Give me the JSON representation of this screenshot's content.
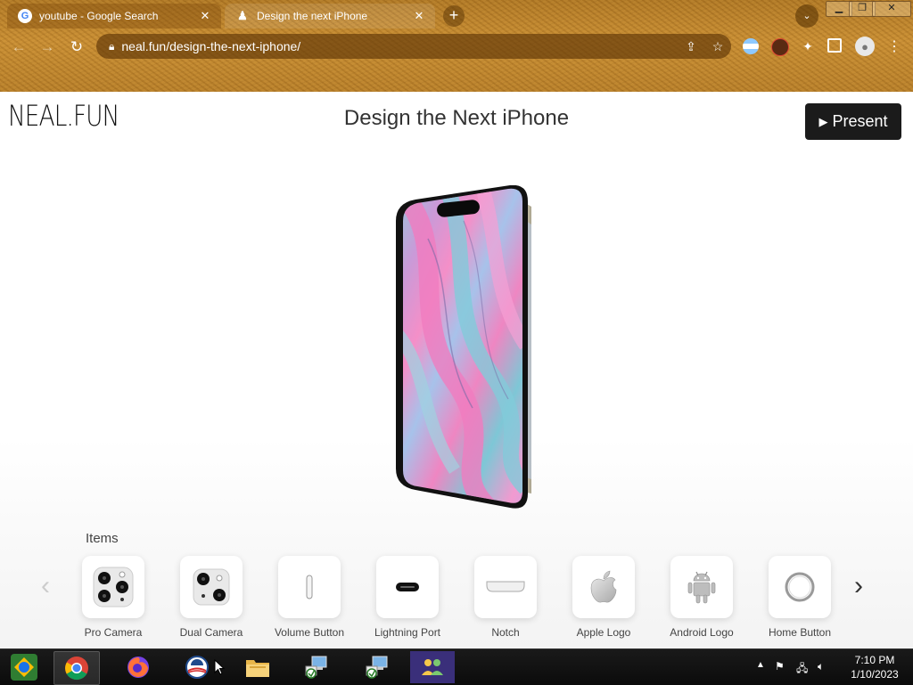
{
  "browser": {
    "tabs": [
      {
        "title": "youtube - Google Search",
        "favicon": "google-icon"
      },
      {
        "title": "Design the next iPhone",
        "favicon": "neal-fun-icon"
      }
    ],
    "new_tab": "+",
    "url": "neal.fun/design-the-next-iphone/"
  },
  "page": {
    "logo": "NEAL.FUN",
    "title": "Design the Next iPhone",
    "present_label": "Present",
    "items_label": "Items",
    "items": [
      {
        "label": "Pro Camera",
        "icon": "pro-camera-icon"
      },
      {
        "label": "Dual Camera",
        "icon": "dual-camera-icon"
      },
      {
        "label": "Volume Button",
        "icon": "volume-button-icon"
      },
      {
        "label": "Lightning Port",
        "icon": "lightning-port-icon"
      },
      {
        "label": "Notch",
        "icon": "notch-icon"
      },
      {
        "label": "Apple Logo",
        "icon": "apple-logo-icon"
      },
      {
        "label": "Android Logo",
        "icon": "android-logo-icon"
      },
      {
        "label": "Home Button",
        "icon": "home-button-icon"
      }
    ]
  },
  "taskbar": {
    "time": "7:10 PM",
    "date": "1/10/2023"
  }
}
